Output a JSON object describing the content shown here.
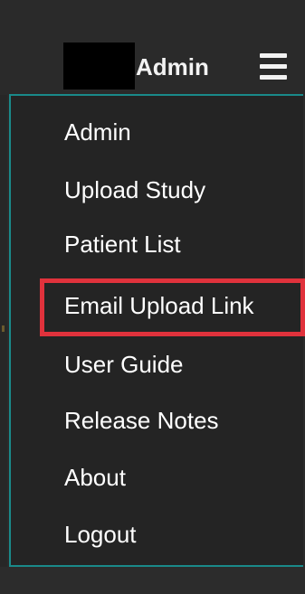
{
  "header": {
    "user_name": "Admin",
    "menu_icon": "hamburger-menu-icon"
  },
  "menu": {
    "items": [
      {
        "label": "Admin"
      },
      {
        "label": "Upload Study"
      },
      {
        "label": "Patient List"
      },
      {
        "label": "Email Upload Link",
        "highlighted": true
      },
      {
        "label": "User Guide"
      },
      {
        "label": "Release Notes"
      },
      {
        "label": "About"
      },
      {
        "label": "Logout"
      }
    ]
  },
  "colors": {
    "background": "#2b2b2b",
    "menu_border": "#1a8a8a",
    "highlight": "#e0323c",
    "text": "#ffffff"
  }
}
